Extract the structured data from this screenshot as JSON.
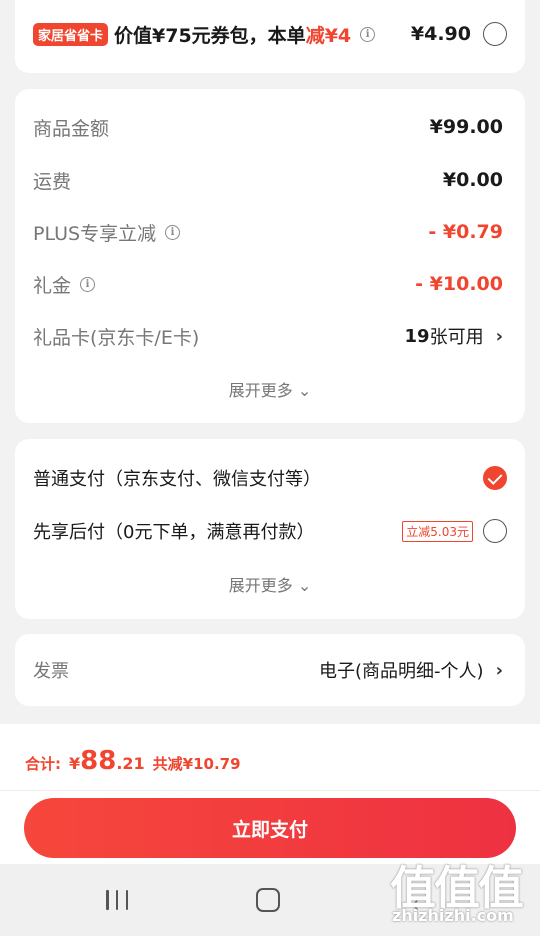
{
  "promo": {
    "badge": "家居省省卡",
    "text_prefix": "价值¥75元券包，本单",
    "text_highlight": "减¥4",
    "info": "i",
    "price": "¥4.90"
  },
  "price_details": {
    "goods_label": "商品金额",
    "goods_value": "¥99.00",
    "shipping_label": "运费",
    "shipping_value": "¥0.00",
    "plus_label": "PLUS专享立减",
    "plus_value": "- ¥0.79",
    "cash_gift_label": "礼金",
    "cash_gift_value": "- ¥10.00",
    "gift_card_label": "礼品卡(京东卡/E卡)",
    "gift_card_count": "19",
    "gift_card_suffix": "张可用",
    "expand_label": "展开更多",
    "info": "i",
    "chevron": "›",
    "expand_chevron": "⌄"
  },
  "payment": {
    "option_normal": "普通支付（京东支付、微信支付等）",
    "option_later": "先享后付（0元下单，满意再付款）",
    "later_tag": "立减5.03元",
    "expand_label": "展开更多",
    "expand_chevron": "⌄"
  },
  "invoice": {
    "label": "发票",
    "value": "电子(商品明细-个人)",
    "chevron": "›"
  },
  "summary": {
    "total_label": "合计:",
    "yen": "¥",
    "total_int": "88",
    "total_dec": ".21",
    "discount": "共减¥10.79",
    "pay_button": "立即支付"
  },
  "nav": {
    "back_glyph": "‹"
  },
  "watermark": {
    "main": "值值值",
    "sub": "zhizhizhi.com"
  },
  "colors": {
    "accent": "#f0452f",
    "background": "#f2f2f2"
  }
}
